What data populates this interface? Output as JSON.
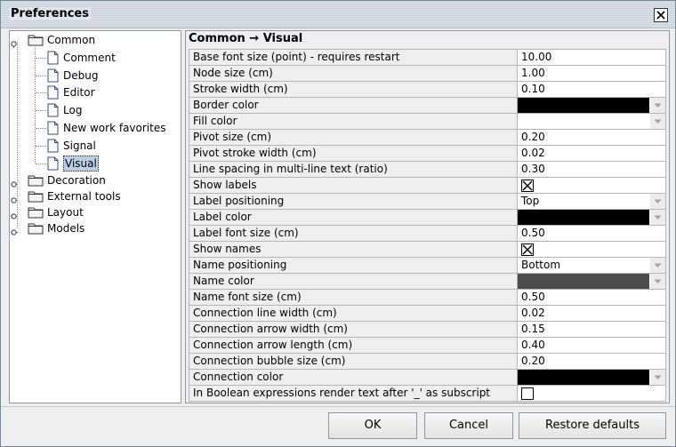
{
  "window": {
    "title": "Preferences",
    "close_icon": "close-icon"
  },
  "tree": {
    "groups": [
      {
        "label": "Common",
        "expanded": true,
        "children": [
          "Comment",
          "Debug",
          "Editor",
          "Log",
          "New work favorites",
          "Signal",
          "Visual"
        ]
      },
      {
        "label": "Decoration",
        "expanded": false
      },
      {
        "label": "External tools",
        "expanded": false
      },
      {
        "label": "Layout",
        "expanded": false
      },
      {
        "label": "Models",
        "expanded": false
      }
    ],
    "selected": "Visual"
  },
  "panel": {
    "title": "Common → Visual",
    "properties": [
      {
        "name": "Base font size (point) - requires restart",
        "type": "text",
        "value": "10.00"
      },
      {
        "name": "Node size (cm)",
        "type": "text",
        "value": "1.00"
      },
      {
        "name": "Stroke width (cm)",
        "type": "text",
        "value": "0.10"
      },
      {
        "name": "Border color",
        "type": "color",
        "color": "#000000"
      },
      {
        "name": "Fill color",
        "type": "color",
        "color": "#ffffff"
      },
      {
        "name": "Pivot size (cm)",
        "type": "text",
        "value": "0.20"
      },
      {
        "name": "Pivot stroke width (cm)",
        "type": "text",
        "value": "0.02"
      },
      {
        "name": "Line spacing in multi-line text (ratio)",
        "type": "text",
        "value": "0.30"
      },
      {
        "name": "Show labels",
        "type": "checkbox",
        "checked": true
      },
      {
        "name": "Label positioning",
        "type": "select",
        "value": "Top"
      },
      {
        "name": "Label color",
        "type": "color",
        "color": "#000000"
      },
      {
        "name": "Label font size (cm)",
        "type": "text",
        "value": "0.50"
      },
      {
        "name": "Show names",
        "type": "checkbox",
        "checked": true
      },
      {
        "name": "Name positioning",
        "type": "select",
        "value": "Bottom"
      },
      {
        "name": "Name color",
        "type": "color",
        "color": "#4d4d4d"
      },
      {
        "name": "Name font size (cm)",
        "type": "text",
        "value": "0.50"
      },
      {
        "name": "Connection line width (cm)",
        "type": "text",
        "value": "0.02"
      },
      {
        "name": "Connection arrow width (cm)",
        "type": "text",
        "value": "0.15"
      },
      {
        "name": "Connection arrow length (cm)",
        "type": "text",
        "value": "0.40"
      },
      {
        "name": "Connection bubble size (cm)",
        "type": "text",
        "value": "0.20"
      },
      {
        "name": "Connection color",
        "type": "color",
        "color": "#000000"
      },
      {
        "name": "In Boolean expressions render text after '_' as subscript",
        "type": "checkbox",
        "checked": false
      }
    ]
  },
  "buttons": {
    "ok": "OK",
    "cancel": "Cancel",
    "restore": "Restore defaults"
  }
}
